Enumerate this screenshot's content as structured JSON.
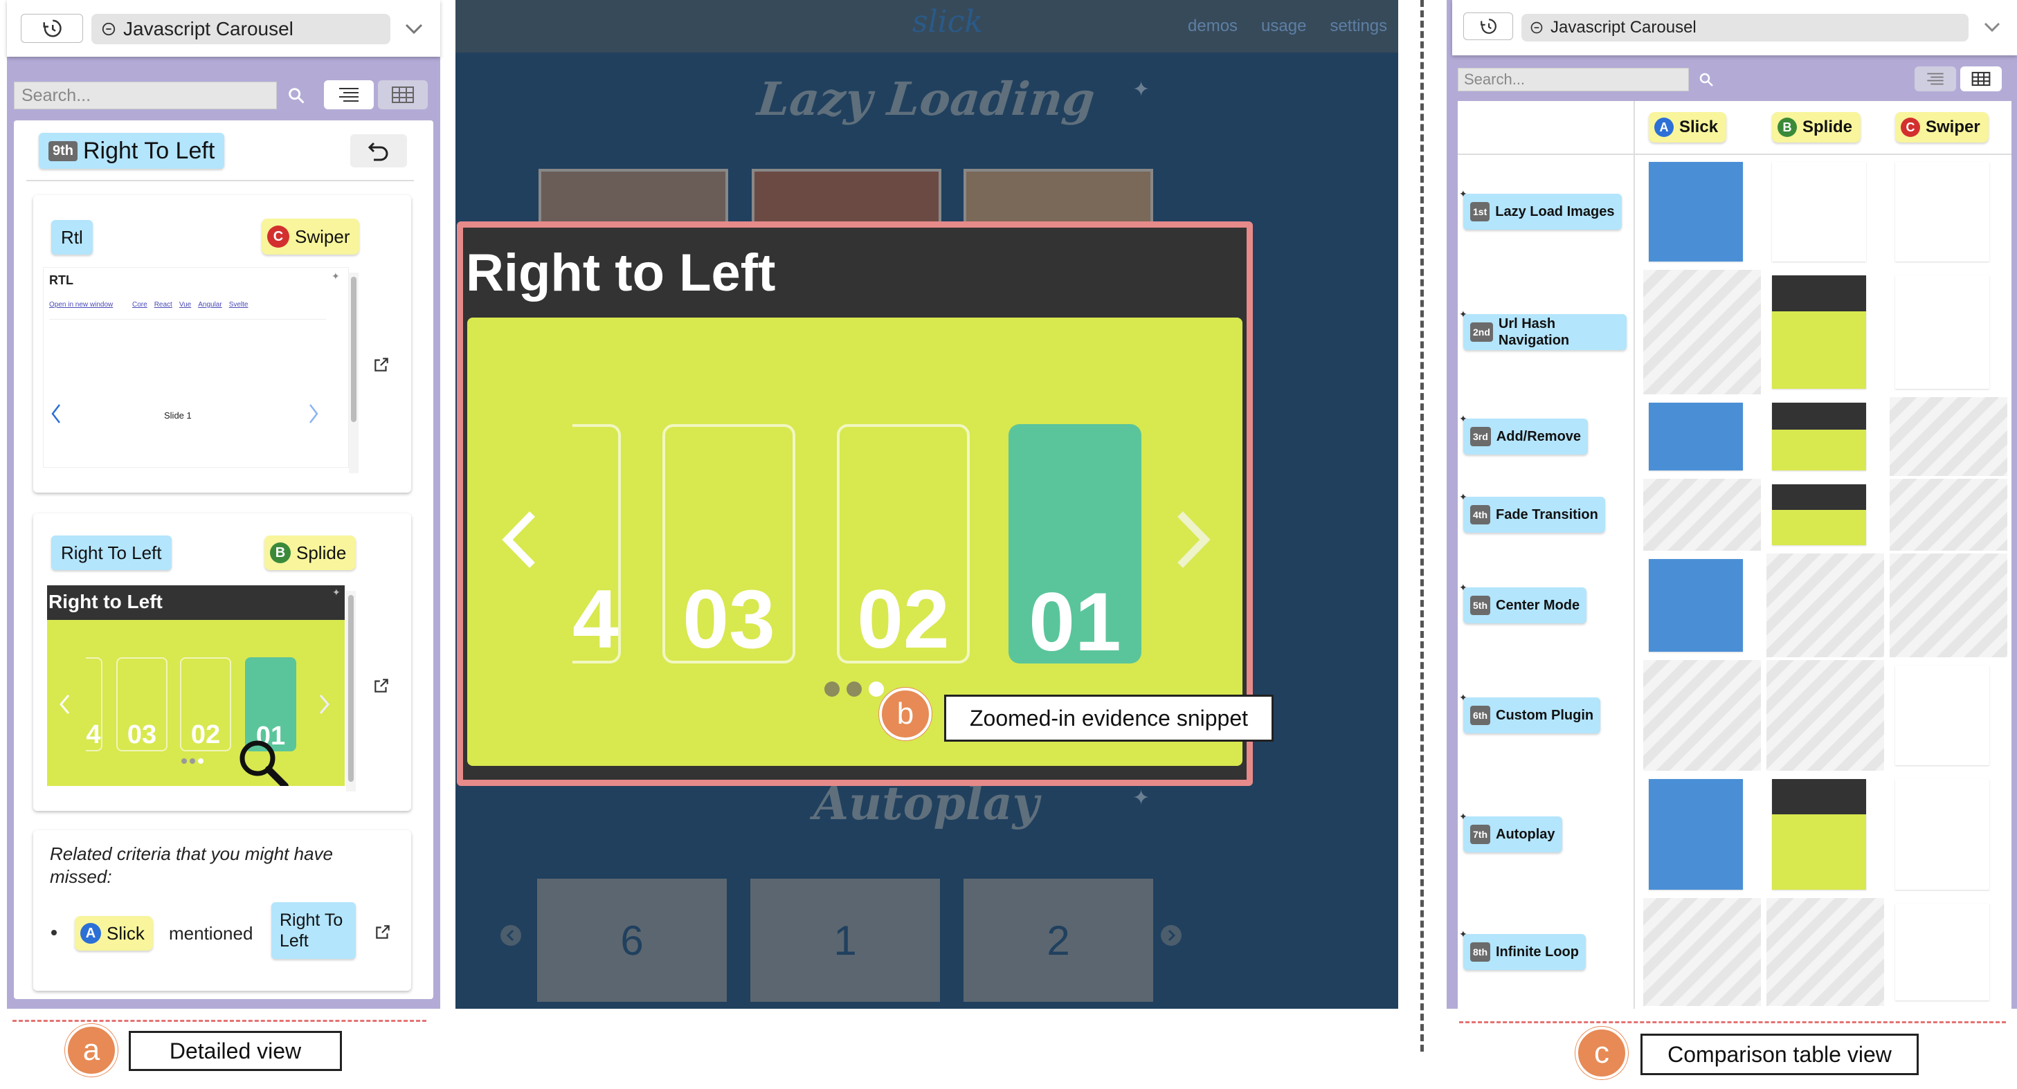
{
  "left": {
    "history_icon": "history-icon",
    "url_text": "Javascript Carousel",
    "search_placeholder": "Search...",
    "header_badge": "9th",
    "header_title": "Right To Left",
    "card1": {
      "tag": "Rtl",
      "lib_letter": "C",
      "lib_name": "Swiper",
      "page_title": "RTL",
      "open_link": "Open in new window",
      "fw_links": [
        "Core",
        "React",
        "Vue",
        "Angular",
        "Svelte"
      ],
      "slide": "Slide 1"
    },
    "card2": {
      "tag": "Right To Left",
      "lib_letter": "B",
      "lib_name": "Splide",
      "page_title": "Right to Left",
      "slides": [
        "4",
        "03",
        "02",
        "01"
      ]
    },
    "related": {
      "text": "Related criteria that you might have missed:",
      "lib_letter": "A",
      "lib_name": "Slick",
      "mentioned": "mentioned",
      "tag": "Right To Left"
    }
  },
  "main": {
    "logo": "slick",
    "nav": [
      "demos",
      "usage",
      "settings"
    ],
    "section1": "Lazy Loading",
    "section2": "Autoplay",
    "bottom_slides": [
      "6",
      "1",
      "2"
    ],
    "overlay_title": "Right to Left",
    "slides": [
      "4",
      "03",
      "02",
      "01"
    ]
  },
  "right": {
    "url_text": "Javascript Carousel",
    "search_placeholder": "Search...",
    "libs": [
      {
        "letter": "A",
        "name": "Slick",
        "color": "#2c6fd6"
      },
      {
        "letter": "B",
        "name": "Splide",
        "color": "#3a8a3a"
      },
      {
        "letter": "C",
        "name": "Swiper",
        "color": "#d32f2f"
      }
    ],
    "rows": [
      {
        "ord": "1st",
        "label": "Lazy Load Images"
      },
      {
        "ord": "2nd",
        "label": "Url Hash Navigation"
      },
      {
        "ord": "3rd",
        "label": "Add/Remove"
      },
      {
        "ord": "4th",
        "label": "Fade Transition"
      },
      {
        "ord": "5th",
        "label": "Center Mode"
      },
      {
        "ord": "6th",
        "label": "Custom Plugin"
      },
      {
        "ord": "7th",
        "label": "Autoplay"
      },
      {
        "ord": "8th",
        "label": "Infinite Loop"
      }
    ]
  },
  "callouts": {
    "a": "a",
    "a_label": "Detailed view",
    "b": "b",
    "b_label": "Zoomed-in evidence snippet",
    "c": "c",
    "c_label": "Comparison table view"
  },
  "colors": {
    "lime": "#d8e84f",
    "teal": "#5ac59b",
    "navy": "#20405e",
    "lavender": "#b3abd6",
    "tag_blue": "#b3e5fc",
    "tag_yellow": "#f8f59c"
  }
}
